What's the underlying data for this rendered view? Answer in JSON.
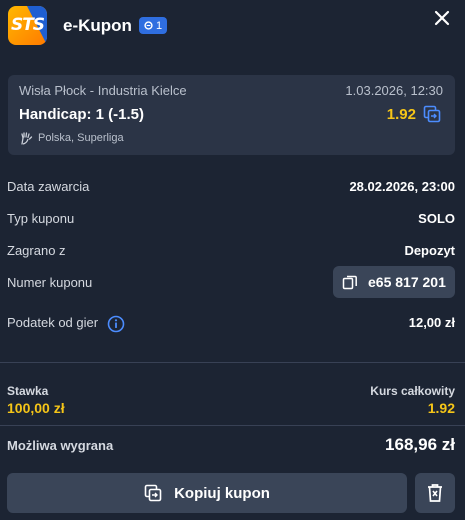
{
  "header": {
    "logo_text": "STS",
    "title": "e-Kupon",
    "selections_count": "1",
    "close_icon": "close-icon"
  },
  "event": {
    "teams": "Wisła Płock - Industria Kielce",
    "date": "1.03.2026, 12:30",
    "bet": "Handicap: 1 (-1.5)",
    "odds": "1.92",
    "league": "Polska, Superliga"
  },
  "details": [
    {
      "label": "Data zawarcia",
      "value": "28.02.2026, 23:00"
    },
    {
      "label": "Typ kuponu",
      "value": "SOLO"
    },
    {
      "label": "Zagrano z",
      "value": "Depozyt"
    },
    {
      "label": "Numer kuponu",
      "value": "e65 817 201"
    },
    {
      "label": "Podatek od gier",
      "value": "12,00 zł"
    }
  ],
  "summary": {
    "stake_label": "Stawka",
    "stake_value": "100,00 zł",
    "total_odds_label": "Kurs całkowity",
    "total_odds_value": "1.92",
    "win_label": "Możliwa wygrana",
    "win_value": "168,96 zł"
  },
  "actions": {
    "copy_label": "Kopiuj kupon"
  },
  "colors": {
    "background": "#1c2433",
    "card": "#2b3446",
    "button": "#3a4558",
    "accent_yellow": "#f5c518",
    "badge_blue": "#2f6ee0"
  }
}
